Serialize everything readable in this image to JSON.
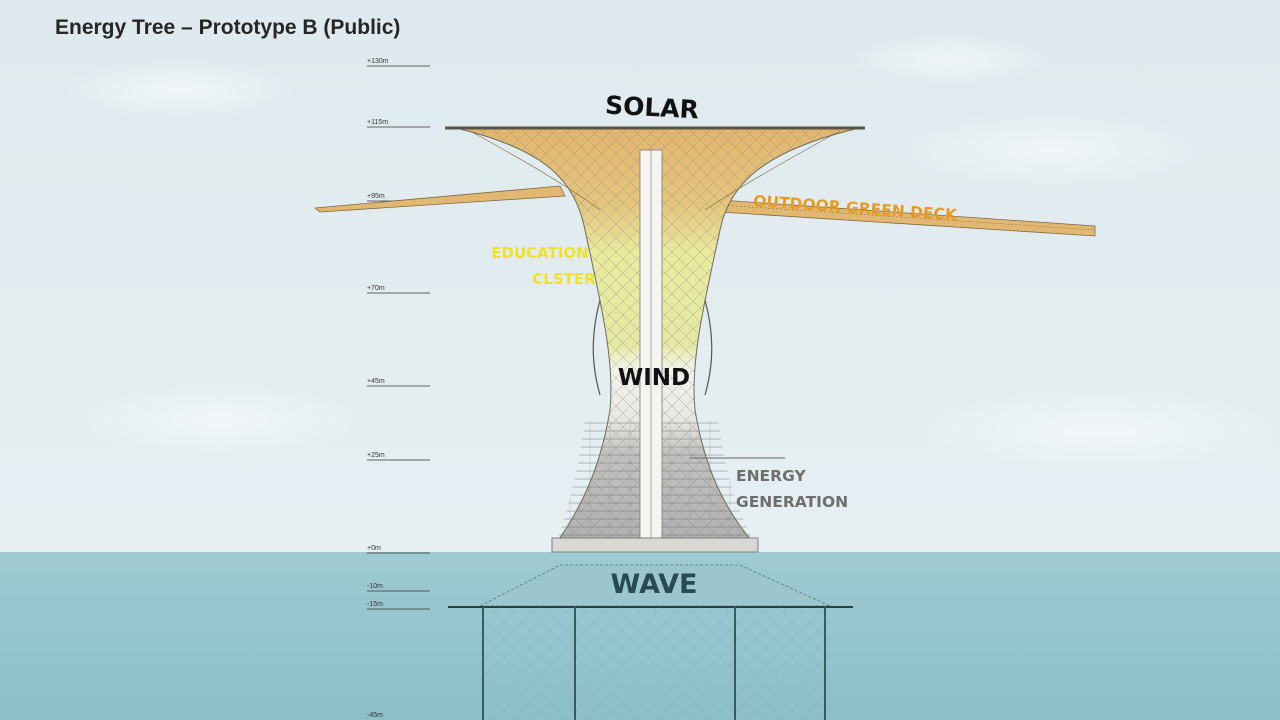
{
  "title": "Energy Tree – Prototype B (Public)",
  "levels": [
    "+130m",
    "+115m",
    "+95m",
    "+70m",
    "+45m",
    "+25m",
    "+0m",
    "-10m",
    "-15m",
    "-45m"
  ],
  "labels": {
    "solar": "SOLAR",
    "outdoor_deck": "OUTDOOR GREEN DECK",
    "education_line1": "EDUCATION",
    "education_line2": "CLSTER",
    "wind": "WIND",
    "energy_line1": "ENERGY",
    "energy_line2": "GENERATION",
    "wave": "WAVE"
  },
  "colors": {
    "solar_zone": "#e2b66e",
    "education_zone": "#e7ea98",
    "wind_zone": "#f2f2ee",
    "energy_zone": "#b9b9b9",
    "deck_label": "#e89b22",
    "education_label": "#f0e326",
    "energy_label": "#6e6e6e",
    "wave_label": "#274a55",
    "sea": "#9fcad2"
  }
}
